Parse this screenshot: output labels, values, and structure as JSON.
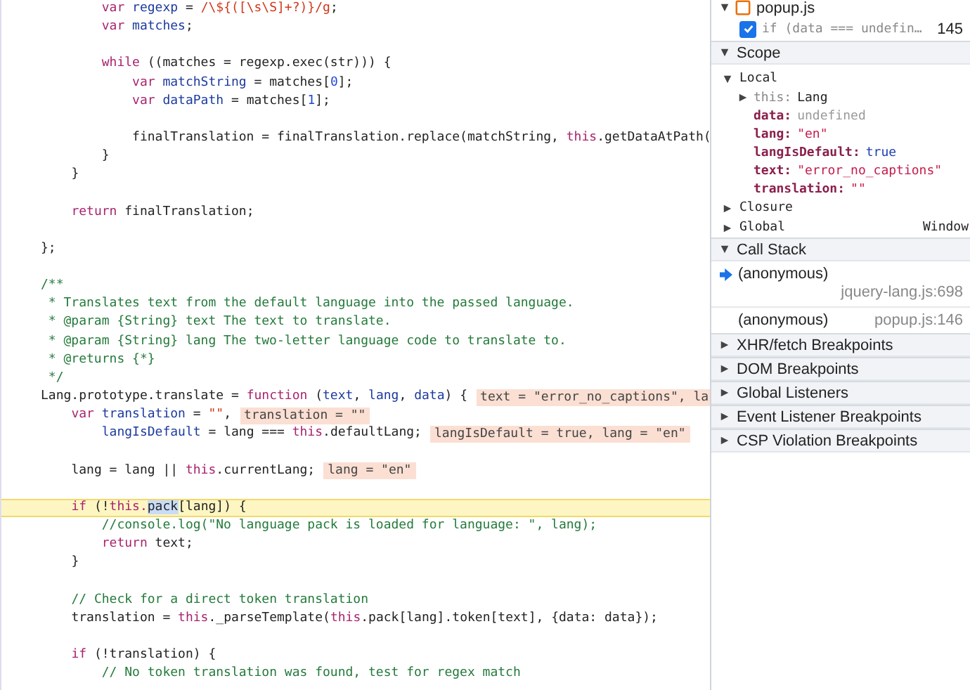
{
  "editor": {
    "lines": [
      {
        "kind": "code",
        "current": false,
        "tokens": [
          {
            "kind": "kw",
            "text": "        var"
          },
          {
            "kind": "def",
            "text": " regexp"
          },
          {
            "kind": "plain",
            "text": " = "
          },
          {
            "kind": "str",
            "text": "/\\${([\\s\\S]+?)}/g"
          },
          {
            "kind": "plain",
            "text": ";"
          }
        ]
      },
      {
        "kind": "code",
        "current": false,
        "tokens": [
          {
            "kind": "kw",
            "text": "        var"
          },
          {
            "kind": "def",
            "text": " matches"
          },
          {
            "kind": "plain",
            "text": ";"
          }
        ]
      },
      {
        "kind": "blank"
      },
      {
        "kind": "code",
        "current": false,
        "tokens": [
          {
            "kind": "kw",
            "text": "        while"
          },
          {
            "kind": "plain",
            "text": " ((matches = regexp.exec(str))) {"
          }
        ]
      },
      {
        "kind": "code",
        "current": false,
        "tokens": [
          {
            "kind": "kw",
            "text": "            var"
          },
          {
            "kind": "def",
            "text": " matchString"
          },
          {
            "kind": "plain",
            "text": " = matches["
          },
          {
            "kind": "num",
            "text": "0"
          },
          {
            "kind": "plain",
            "text": "];"
          }
        ]
      },
      {
        "kind": "code",
        "current": false,
        "tokens": [
          {
            "kind": "kw",
            "text": "            var"
          },
          {
            "kind": "def",
            "text": " dataPath"
          },
          {
            "kind": "plain",
            "text": " = matches["
          },
          {
            "kind": "num",
            "text": "1"
          },
          {
            "kind": "plain",
            "text": "];"
          }
        ]
      },
      {
        "kind": "blank"
      },
      {
        "kind": "code",
        "current": false,
        "tokens": [
          {
            "kind": "plain",
            "text": "            finalTranslation = finalTranslation.replace(matchString, "
          },
          {
            "kind": "kw",
            "text": "this"
          },
          {
            "kind": "plain",
            "text": ".getDataAtPath("
          }
        ]
      },
      {
        "kind": "code",
        "current": false,
        "tokens": [
          {
            "kind": "plain",
            "text": "        }"
          }
        ]
      },
      {
        "kind": "code",
        "current": false,
        "tokens": [
          {
            "kind": "plain",
            "text": "    }"
          }
        ]
      },
      {
        "kind": "blank"
      },
      {
        "kind": "code",
        "current": false,
        "tokens": [
          {
            "kind": "kw",
            "text": "    return"
          },
          {
            "kind": "plain",
            "text": " finalTranslation;"
          }
        ]
      },
      {
        "kind": "blank"
      },
      {
        "kind": "code",
        "current": false,
        "tokens": [
          {
            "kind": "plain",
            "text": "};"
          }
        ]
      },
      {
        "kind": "blank"
      },
      {
        "kind": "code",
        "current": false,
        "tokens": [
          {
            "kind": "com",
            "text": "/**"
          }
        ]
      },
      {
        "kind": "code",
        "current": false,
        "tokens": [
          {
            "kind": "com",
            "text": " * Translates text from the default language into the passed language."
          }
        ]
      },
      {
        "kind": "code",
        "current": false,
        "tokens": [
          {
            "kind": "com",
            "text": " * @param {String} text The text to translate."
          }
        ]
      },
      {
        "kind": "code",
        "current": false,
        "tokens": [
          {
            "kind": "com",
            "text": " * @param {String} lang The two-letter language code to translate to."
          }
        ]
      },
      {
        "kind": "code",
        "current": false,
        "tokens": [
          {
            "kind": "com",
            "text": " * @returns {*}"
          }
        ]
      },
      {
        "kind": "code",
        "current": false,
        "tokens": [
          {
            "kind": "com",
            "text": " */"
          }
        ]
      },
      {
        "kind": "code",
        "current": false,
        "tokens": [
          {
            "kind": "plain",
            "text": "Lang.prototype.translate = "
          },
          {
            "kind": "kw",
            "text": "function"
          },
          {
            "kind": "plain",
            "text": " ("
          },
          {
            "kind": "def",
            "text": "text"
          },
          {
            "kind": "plain",
            "text": ", "
          },
          {
            "kind": "def",
            "text": "lang"
          },
          {
            "kind": "plain",
            "text": ", "
          },
          {
            "kind": "def",
            "text": "data"
          },
          {
            "kind": "plain",
            "text": ") {"
          }
        ],
        "inline_values": [
          "text = \"error_no_captions\", la"
        ]
      },
      {
        "kind": "code",
        "current": false,
        "tokens": [
          {
            "kind": "kw",
            "text": "    var"
          },
          {
            "kind": "def",
            "text": " translation"
          },
          {
            "kind": "plain",
            "text": " = "
          },
          {
            "kind": "str",
            "text": "\"\""
          },
          {
            "kind": "plain",
            "text": ","
          }
        ],
        "inline_values": [
          "translation = \"\""
        ]
      },
      {
        "kind": "code",
        "current": false,
        "tokens": [
          {
            "kind": "def",
            "text": "        langIsDefault"
          },
          {
            "kind": "plain",
            "text": " = lang === "
          },
          {
            "kind": "kw",
            "text": "this"
          },
          {
            "kind": "plain",
            "text": ".defaultLang;"
          }
        ],
        "inline_values": [
          "langIsDefault = true, lang = \"en\""
        ]
      },
      {
        "kind": "blank"
      },
      {
        "kind": "code",
        "current": false,
        "tokens": [
          {
            "kind": "plain",
            "text": "    lang = lang || "
          },
          {
            "kind": "kw",
            "text": "this"
          },
          {
            "kind": "plain",
            "text": ".currentLang;"
          }
        ],
        "inline_values": [
          "lang = \"en\""
        ]
      },
      {
        "kind": "blank"
      },
      {
        "kind": "code",
        "current": true,
        "tokens": [
          {
            "kind": "kw",
            "text": "    if"
          },
          {
            "kind": "plain",
            "text": " (!"
          },
          {
            "kind": "kw",
            "text": "this."
          },
          {
            "kind": "sel",
            "text": "pack"
          },
          {
            "kind": "plain",
            "text": "[lang]) {"
          }
        ]
      },
      {
        "kind": "code",
        "current": false,
        "tokens": [
          {
            "kind": "com",
            "text": "        //console.log(\"No language pack is loaded for language: \", lang);"
          }
        ]
      },
      {
        "kind": "code",
        "current": false,
        "tokens": [
          {
            "kind": "kw",
            "text": "        return"
          },
          {
            "kind": "plain",
            "text": " text;"
          }
        ]
      },
      {
        "kind": "code",
        "current": false,
        "tokens": [
          {
            "kind": "plain",
            "text": "    }"
          }
        ]
      },
      {
        "kind": "blank"
      },
      {
        "kind": "code",
        "current": false,
        "tokens": [
          {
            "kind": "com",
            "text": "    // Check for a direct token translation"
          }
        ]
      },
      {
        "kind": "code",
        "current": false,
        "tokens": [
          {
            "kind": "plain",
            "text": "    translation = "
          },
          {
            "kind": "kw",
            "text": "this"
          },
          {
            "kind": "plain",
            "text": "._parseTemplate("
          },
          {
            "kind": "kw",
            "text": "this"
          },
          {
            "kind": "plain",
            "text": ".pack[lang].token[text], {data: data});"
          }
        ]
      },
      {
        "kind": "blank"
      },
      {
        "kind": "code",
        "current": false,
        "tokens": [
          {
            "kind": "kw",
            "text": "    if"
          },
          {
            "kind": "plain",
            "text": " (!translation) {"
          }
        ]
      },
      {
        "kind": "code",
        "current": false,
        "tokens": [
          {
            "kind": "com",
            "text": "        // No token translation was found, test for regex match"
          }
        ]
      }
    ]
  },
  "sidebar": {
    "breakpoint_file": {
      "name": "popup.js",
      "expanded": true
    },
    "breakpoints": [
      {
        "checked": true,
        "code": "if (data === undefin…",
        "line": "145"
      }
    ],
    "sections": [
      {
        "kind": "scope",
        "title": "Scope",
        "expanded": true,
        "scopes": [
          {
            "title": "Local",
            "expanded": true,
            "variables": [
              {
                "name": "this:",
                "value": "Lang",
                "expandable": true,
                "dimmed_name": true,
                "kind": "object"
              },
              {
                "name": "data:",
                "value": "undefined",
                "expandable": false,
                "dimmed_name": false,
                "kind": "undefined"
              },
              {
                "name": "lang:",
                "value": "\"en\"",
                "expandable": false,
                "dimmed_name": false,
                "kind": "string"
              },
              {
                "name": "langIsDefault:",
                "value": "true",
                "expandable": false,
                "dimmed_name": false,
                "kind": "boolean"
              },
              {
                "name": "text:",
                "value": "\"error_no_captions\"",
                "expandable": false,
                "dimmed_name": false,
                "kind": "string"
              },
              {
                "name": "translation:",
                "value": "\"\"",
                "expandable": false,
                "dimmed_name": false,
                "kind": "string"
              }
            ]
          },
          {
            "title": "Closure",
            "expanded": false
          },
          {
            "title": "Global",
            "expanded": false,
            "value": "Window"
          }
        ]
      },
      {
        "kind": "callstack",
        "title": "Call Stack",
        "expanded": true,
        "frames": [
          {
            "function": "(anonymous)",
            "location": "jquery-lang.js:698",
            "selected": true
          },
          {
            "function": "(anonymous)",
            "location": "popup.js:146",
            "selected": false
          }
        ]
      },
      {
        "title": "XHR/fetch Breakpoints",
        "expanded": false
      },
      {
        "title": "DOM Breakpoints",
        "expanded": false
      },
      {
        "title": "Global Listeners",
        "expanded": false
      },
      {
        "title": "Event Listener Breakpoints",
        "expanded": false
      },
      {
        "title": "CSP Violation Breakpoints",
        "expanded": false
      }
    ]
  }
}
